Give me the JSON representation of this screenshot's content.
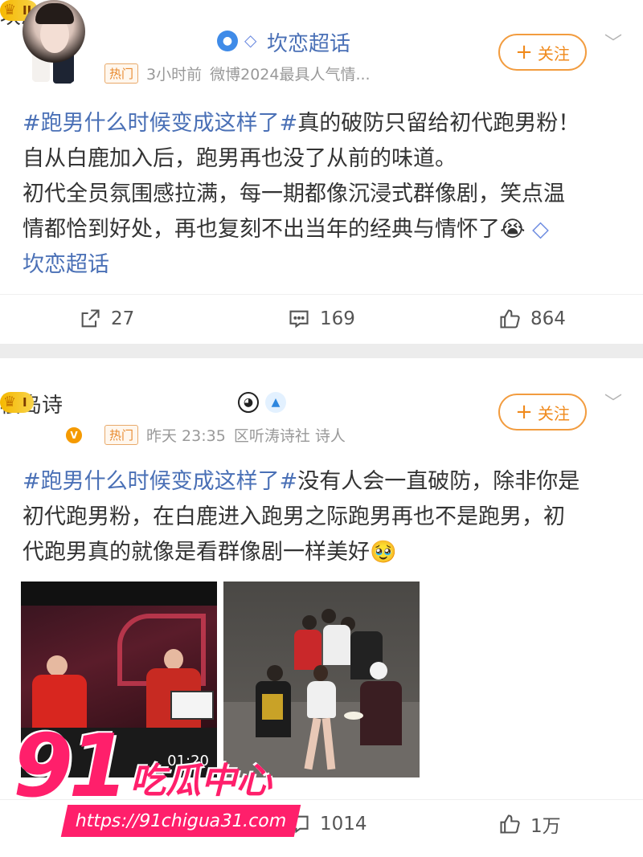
{
  "posts": [
    {
      "author": "坎恋",
      "level": "II",
      "super_topic": "坎恋超话",
      "hot_tag": "热门",
      "time": "3小时前",
      "source": "微博2024最具人气情...",
      "follow_label": "关注",
      "body": {
        "hashtag": "#跑男什么时候变成这样了#",
        "line1_rest": "真的破防只留给初代跑男粉！",
        "line2": "自从白鹿加入后，跑男再也没了从前的味道。",
        "line3": "初代全员氛围感拉满，每一期都像沉浸式群像剧，笑点温",
        "line4": "情都恰到好处，再也复刻不出当年的经典与情怀了",
        "emoji": "😭",
        "topic_link": "坎恋超话"
      },
      "actions": {
        "repost": "27",
        "comment": "169",
        "like": "864"
      }
    },
    {
      "author": "樱岛诗",
      "level": "I",
      "hot_tag": "热门",
      "time": "昨天 23:35",
      "source": "区听涛诗社 诗人",
      "follow_label": "关注",
      "body": {
        "hashtag": "#跑男什么时候变成这样了#",
        "line1_rest": "没有人会一直破防，除非你是",
        "line2": "初代跑男粉，在白鹿进入跑男之际跑男再也不是跑男，初",
        "line3": "代跑男真的就像是看群像剧一样美好",
        "emoji": "🥹"
      },
      "images": [
        {
          "caption": "01:20"
        },
        {
          "caption": ""
        }
      ],
      "actions": {
        "comment": "1014",
        "like": "1万"
      }
    }
  ],
  "watermark": {
    "number": "91",
    "brand": "吃瓜中心",
    "url": "https://91chigua31.com"
  },
  "colors": {
    "link": "#4a70b6",
    "accent": "#f08a1c",
    "watermark": "#ff1f6b"
  }
}
